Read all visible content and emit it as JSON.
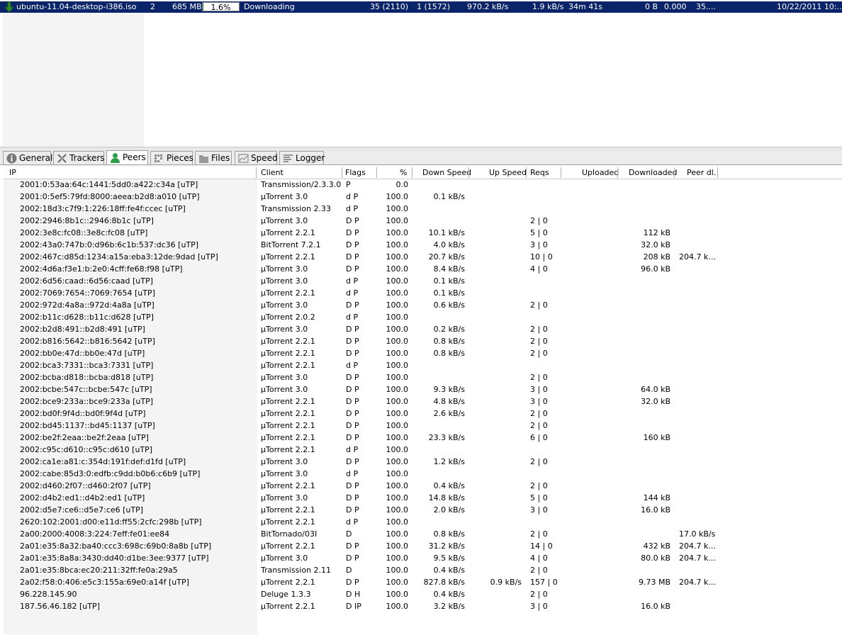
{
  "torrent": {
    "name": "ubuntu-11.04-desktop-i386.iso",
    "number": "2",
    "size": "685 MB",
    "progress_text": "1.6%",
    "progress": 0.016,
    "status": "Downloading",
    "seeds": "35 (2110)",
    "peers": "1 (1572)",
    "down_speed": "970.2 kB/s",
    "up_speed": "1.9 kB/s",
    "eta": "34m 41s",
    "uploaded": "0 B",
    "ratio": "0.000",
    "avail": "35....",
    "added": "10/22/2011 10:..."
  },
  "tabs": [
    {
      "label": "General",
      "icon": "info-icon"
    },
    {
      "label": "Trackers",
      "icon": "trackers-icon"
    },
    {
      "label": "Peers",
      "icon": "peers-icon"
    },
    {
      "label": "Pieces",
      "icon": "pieces-icon"
    },
    {
      "label": "Files",
      "icon": "folder-icon"
    },
    {
      "label": "Speed",
      "icon": "speed-graph-icon"
    },
    {
      "label": "Logger",
      "icon": "logger-icon"
    }
  ],
  "active_tab": "Peers",
  "columns": {
    "ip": "IP",
    "client": "Client",
    "flags": "Flags",
    "pct": "%",
    "down": "Down Speed",
    "up": "Up Speed",
    "reqs": "Reqs",
    "uploaded": "Uploaded",
    "downloaded": "Downloaded",
    "peerdl": "Peer dl."
  },
  "peers": [
    [
      "2001:0:53aa:64c:1441:5dd0:a422:c34a [uTP]",
      "Transmission/2.3.3.0",
      "P",
      "0.0",
      "",
      "",
      "",
      "",
      "",
      ""
    ],
    [
      "2001:0:5ef5:79fd:8000:aeea:b2d8:a010 [uTP]",
      "µTorrent 3.0",
      "d P",
      "100.0",
      "0.1 kB/s",
      "",
      "",
      "",
      "",
      ""
    ],
    [
      "2002:18d3:c7f9:1:226:18ff:fe4f:ccec [uTP]",
      "Transmission 2.33",
      "d P",
      "100.0",
      "",
      "",
      "",
      "",
      "",
      ""
    ],
    [
      "2002:2946:8b1c::2946:8b1c [uTP]",
      "µTorrent 3.0",
      "D P",
      "100.0",
      "",
      "",
      "2 | 0",
      "",
      "",
      ""
    ],
    [
      "2002:3e8c:fc08::3e8c:fc08 [uTP]",
      "µTorrent 2.2.1",
      "D P",
      "100.0",
      "10.1 kB/s",
      "",
      "5 | 0",
      "",
      "112 kB",
      ""
    ],
    [
      "2002:43a0:747b:0:d96b:6c1b:537:dc36 [uTP]",
      "BitTorrent 7.2.1",
      "D P",
      "100.0",
      "4.0 kB/s",
      "",
      "3 | 0",
      "",
      "32.0 kB",
      ""
    ],
    [
      "2002:467c:d85d:1234:a15a:eba3:12de:9dad [uTP]",
      "µTorrent 2.2.1",
      "D P",
      "100.0",
      "20.7 kB/s",
      "",
      "10 | 0",
      "",
      "208 kB",
      "204.7 k..."
    ],
    [
      "2002:4d6a:f3e1:b:2e0:4cff:fe68:f98 [uTP]",
      "µTorrent 3.0",
      "D P",
      "100.0",
      "8.4 kB/s",
      "",
      "4 | 0",
      "",
      "96.0 kB",
      ""
    ],
    [
      "2002:6d56:caad::6d56:caad [uTP]",
      "µTorrent 3.0",
      "d P",
      "100.0",
      "0.1 kB/s",
      "",
      "",
      "",
      "",
      ""
    ],
    [
      "2002:7069:7654::7069:7654 [uTP]",
      "µTorrent 2.2.1",
      "d P",
      "100.0",
      "0.1 kB/s",
      "",
      "",
      "",
      "",
      ""
    ],
    [
      "2002:972d:4a8a::972d:4a8a [uTP]",
      "µTorrent 3.0",
      "D P",
      "100.0",
      "0.6 kB/s",
      "",
      "2 | 0",
      "",
      "",
      ""
    ],
    [
      "2002:b11c:d628::b11c:d628 [uTP]",
      "µTorrent 2.0.2",
      "d P",
      "100.0",
      "",
      "",
      "",
      "",
      "",
      ""
    ],
    [
      "2002:b2d8:491::b2d8:491 [uTP]",
      "µTorrent 3.0",
      "D P",
      "100.0",
      "0.2 kB/s",
      "",
      "2 | 0",
      "",
      "",
      ""
    ],
    [
      "2002:b816:5642::b816:5642 [uTP]",
      "µTorrent 2.2.1",
      "D P",
      "100.0",
      "0.8 kB/s",
      "",
      "2 | 0",
      "",
      "",
      ""
    ],
    [
      "2002:bb0e:47d::bb0e:47d [uTP]",
      "µTorrent 2.2.1",
      "D P",
      "100.0",
      "0.8 kB/s",
      "",
      "2 | 0",
      "",
      "",
      ""
    ],
    [
      "2002:bca3:7331::bca3:7331 [uTP]",
      "µTorrent 2.2.1",
      "d P",
      "100.0",
      "",
      "",
      "",
      "",
      "",
      ""
    ],
    [
      "2002:bcba:d818::bcba:d818 [uTP]",
      "µTorrent 3.0",
      "D P",
      "100.0",
      "",
      "",
      "2 | 0",
      "",
      "",
      ""
    ],
    [
      "2002:bcbe:547c::bcbe:547c [uTP]",
      "µTorrent 3.0",
      "D P",
      "100.0",
      "9.3 kB/s",
      "",
      "3 | 0",
      "",
      "64.0 kB",
      ""
    ],
    [
      "2002:bce9:233a::bce9:233a [uTP]",
      "µTorrent 2.2.1",
      "D P",
      "100.0",
      "4.8 kB/s",
      "",
      "3 | 0",
      "",
      "32.0 kB",
      ""
    ],
    [
      "2002:bd0f:9f4d::bd0f:9f4d [uTP]",
      "µTorrent 2.2.1",
      "D P",
      "100.0",
      "2.6 kB/s",
      "",
      "2 | 0",
      "",
      "",
      ""
    ],
    [
      "2002:bd45:1137::bd45:1137 [uTP]",
      "µTorrent 2.2.1",
      "D P",
      "100.0",
      "",
      "",
      "2 | 0",
      "",
      "",
      ""
    ],
    [
      "2002:be2f:2eaa::be2f:2eaa [uTP]",
      "µTorrent 2.2.1",
      "D P",
      "100.0",
      "23.3 kB/s",
      "",
      "6 | 0",
      "",
      "160 kB",
      ""
    ],
    [
      "2002:c95c:d610::c95c:d610 [uTP]",
      "µTorrent 2.2.1",
      "d P",
      "100.0",
      "",
      "",
      "",
      "",
      "",
      ""
    ],
    [
      "2002:ca1e:a81:c:354d:191f:def:d1fd [uTP]",
      "µTorrent 3.0",
      "D P",
      "100.0",
      "1.2 kB/s",
      "",
      "2 | 0",
      "",
      "",
      ""
    ],
    [
      "2002:cabe:85d3:0:edfb:c9dd:b0b6:c6b9 [uTP]",
      "µTorrent 3.0",
      "d P",
      "100.0",
      "",
      "",
      "",
      "",
      "",
      ""
    ],
    [
      "2002:d460:2f07::d460:2f07 [uTP]",
      "µTorrent 2.2.1",
      "D P",
      "100.0",
      "0.4 kB/s",
      "",
      "2 | 0",
      "",
      "",
      ""
    ],
    [
      "2002:d4b2:ed1::d4b2:ed1 [uTP]",
      "µTorrent 3.0",
      "D P",
      "100.0",
      "14.8 kB/s",
      "",
      "5 | 0",
      "",
      "144 kB",
      ""
    ],
    [
      "2002:d5e7:ce6::d5e7:ce6 [uTP]",
      "µTorrent 2.2.1",
      "D P",
      "100.0",
      "2.0 kB/s",
      "",
      "3 | 0",
      "",
      "16.0 kB",
      ""
    ],
    [
      "2620:102:2001:d00:e11d:ff55:2cfc:298b [uTP]",
      "µTorrent 2.2.1",
      "d P",
      "100.0",
      "",
      "",
      "",
      "",
      "",
      ""
    ],
    [
      "2a00:2000:4008:3:224:7eff:fe01:ee84",
      "BitTornado/03I",
      "D",
      "100.0",
      "0.8 kB/s",
      "",
      "2 | 0",
      "",
      "",
      "17.0 kB/s"
    ],
    [
      "2a01:e35:8a32:ba40:ccc3:698c:69b0:8a8b [uTP]",
      "µTorrent 2.2.1",
      "D P",
      "100.0",
      "31.2 kB/s",
      "",
      "14 | 0",
      "",
      "432 kB",
      "204.7 k..."
    ],
    [
      "2a01:e35:8a8a:3430:dd40:d1be:3ee:9377 [uTP]",
      "µTorrent 3.0",
      "D P",
      "100.0",
      "9.5 kB/s",
      "",
      "4 | 0",
      "",
      "80.0 kB",
      "204.7 k..."
    ],
    [
      "2a01:e35:8bca:ec20:211:32ff:fe0a:29a5",
      "Transmission 2.11",
      "D",
      "100.0",
      "0.4 kB/s",
      "",
      "2 | 0",
      "",
      "",
      ""
    ],
    [
      "2a02:f58:0:406:e5c3:155a:69e0:a14f [uTP]",
      "µTorrent 2.2.1",
      "D P",
      "100.0",
      "827.8 kB/s",
      "0.9 kB/s",
      "157 | 0",
      "",
      "9.73 MB",
      "204.7 k..."
    ],
    [
      "96.228.145.90",
      "Deluge 1.3.3",
      "D H",
      "100.0",
      "0.4 kB/s",
      "",
      "2 | 0",
      "",
      "",
      ""
    ],
    [
      "187.56.46.182 [uTP]",
      "µTorrent 2.2.1",
      "D IP",
      "100.0",
      "3.2 kB/s",
      "",
      "3 | 0",
      "",
      "16.0 kB",
      ""
    ]
  ]
}
